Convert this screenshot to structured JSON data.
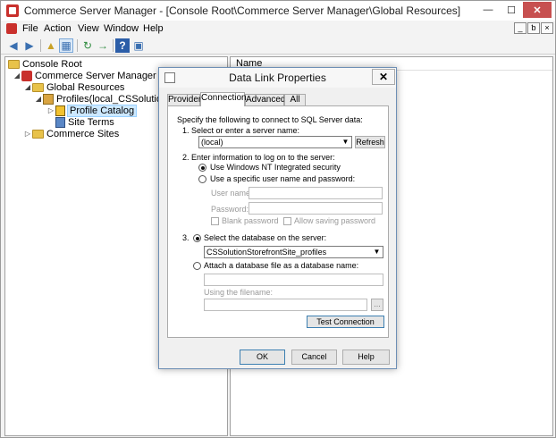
{
  "window": {
    "title": "Commerce Server Manager - [Console Root\\Commerce Server Manager\\Global Resources]",
    "min": "—",
    "max": "☐",
    "close": "✕"
  },
  "menu": {
    "items": [
      "File",
      "Action",
      "View",
      "Window",
      "Help"
    ],
    "mdi": [
      "_",
      "ƅ",
      "×"
    ]
  },
  "toolbar": {
    "back": "◀",
    "forward": "▶",
    "up": "▲",
    "show_tree": "▦",
    "refresh": "↻",
    "export": "→",
    "help": "?",
    "properties": "▣"
  },
  "tree": {
    "items": [
      {
        "label": "Console Root"
      },
      {
        "label": "Commerce Server Manager"
      },
      {
        "label": "Global Resources"
      },
      {
        "label": "Profiles(local_CSSolutionStor"
      },
      {
        "label": "Profile Catalog"
      },
      {
        "label": "Site Terms"
      },
      {
        "label": "Commerce Sites"
      }
    ]
  },
  "list": {
    "column_name": "Name"
  },
  "dialog": {
    "title": "Data Link Properties",
    "close": "✕",
    "tabs": [
      "Provider",
      "Connection",
      "Advanced",
      "All"
    ],
    "active_tab": "Connection",
    "intro": "Specify the following to connect to SQL Server data:",
    "step1": "1. Select or enter a server name:",
    "server_value": "(local)",
    "refresh": "Refresh",
    "step2": "2. Enter information to log on to the server:",
    "auth_nt": "Use Windows NT Integrated security",
    "auth_specific": "Use a specific user name and password:",
    "user_name_label": "User name:",
    "password_label": "Password:",
    "blank_password": "Blank password",
    "allow_saving": "Allow saving password",
    "step3_num": "3.",
    "step3_label": "Select the database on the server:",
    "database_value": "CSSolutionStorefrontSite_profiles",
    "attach_label": "Attach a database file as a database name:",
    "using_filename": "Using the filename:",
    "browse": "...",
    "test_connection": "Test Connection",
    "ok": "OK",
    "cancel": "Cancel",
    "help": "Help",
    "dropdown_arrow": "▼"
  }
}
